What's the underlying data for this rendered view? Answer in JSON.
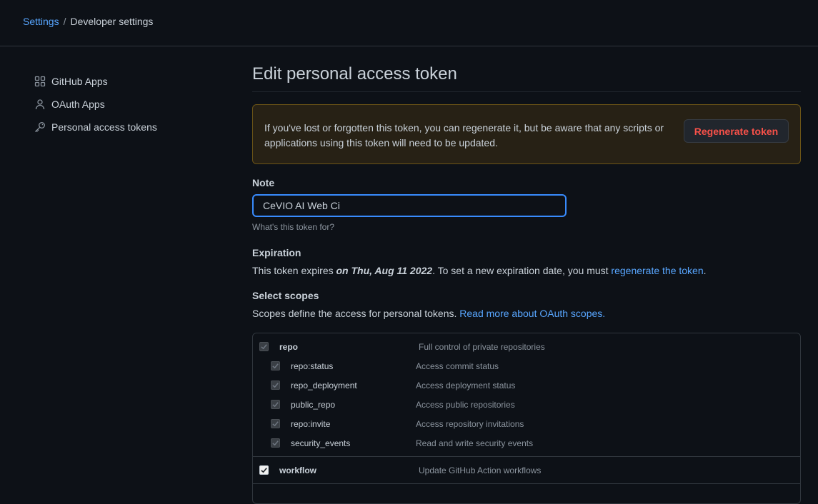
{
  "breadcrumb": {
    "root": "Settings",
    "separator": "/",
    "current": "Developer settings"
  },
  "sidebar": {
    "items": [
      {
        "label": "GitHub Apps",
        "icon": "apps-icon"
      },
      {
        "label": "OAuth Apps",
        "icon": "person-icon"
      },
      {
        "label": "Personal access tokens",
        "icon": "key-icon"
      }
    ]
  },
  "main": {
    "title": "Edit personal access token",
    "flash": {
      "text": "If you've lost or forgotten this token, you can regenerate it, but be aware that any scripts or applications using this token will need to be updated.",
      "button": "Regenerate token"
    },
    "note": {
      "label": "Note",
      "value": "CeVIO AI Web Ci",
      "hint": "What's this token for?"
    },
    "expiration": {
      "label": "Expiration",
      "prefix": "This token expires ",
      "date": "on Thu, Aug 11 2022",
      "middle": ". To set a new expiration date, you must ",
      "link": "regenerate the token",
      "suffix": "."
    },
    "scopes": {
      "label": "Select scopes",
      "text": "Scopes define the access for personal tokens. ",
      "link": "Read more about OAuth scopes.",
      "items": [
        {
          "name": "repo",
          "desc": "Full control of private repositories",
          "checked": true,
          "disabled": true
        },
        {
          "name": "repo:status",
          "desc": "Access commit status",
          "checked": true,
          "disabled": true
        },
        {
          "name": "repo_deployment",
          "desc": "Access deployment status",
          "checked": true,
          "disabled": true
        },
        {
          "name": "public_repo",
          "desc": "Access public repositories",
          "checked": true,
          "disabled": true
        },
        {
          "name": "repo:invite",
          "desc": "Access repository invitations",
          "checked": true,
          "disabled": true
        },
        {
          "name": "security_events",
          "desc": "Read and write security events",
          "checked": true,
          "disabled": true
        },
        {
          "name": "workflow",
          "desc": "Update GitHub Action workflows",
          "checked": true,
          "disabled": false
        }
      ]
    }
  },
  "colors": {
    "background": "#0d1117",
    "link": "#58a6ff",
    "danger": "#f85149",
    "warning_bg": "#272115",
    "warning_border": "#6b5416",
    "focus_border": "#388bfd"
  }
}
